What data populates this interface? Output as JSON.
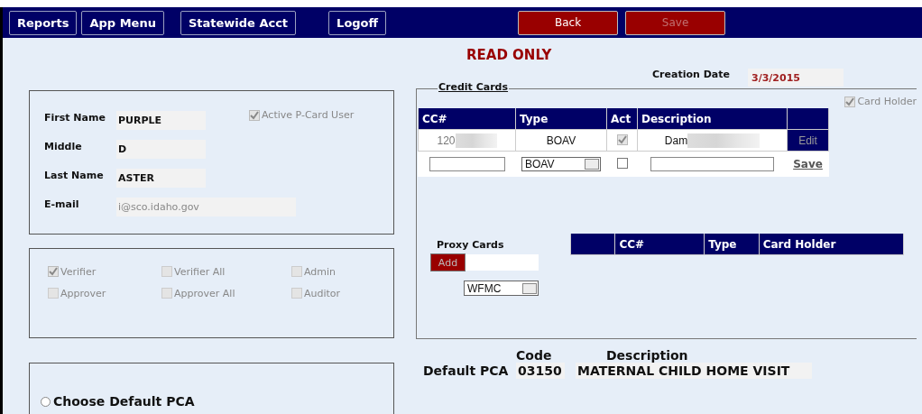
{
  "nav": {
    "buttons": [
      {
        "label": "Reports",
        "kind": "outline",
        "disabled": false
      },
      {
        "label": "App Menu",
        "kind": "outline",
        "disabled": false
      },
      {
        "label": "Statewide Acct",
        "kind": "outline",
        "disabled": false
      },
      {
        "label": "Logoff",
        "kind": "outline",
        "disabled": false
      },
      {
        "label": "Back",
        "kind": "primary",
        "disabled": false
      },
      {
        "label": "Save",
        "kind": "primary",
        "disabled": true
      }
    ]
  },
  "status": "READ ONLY",
  "creation_date": {
    "label": "Creation Date",
    "value": "3/3/2015"
  },
  "user": {
    "fields": [
      {
        "label": "First Name",
        "value": "PURPLE"
      },
      {
        "label": "Middle",
        "value": "D"
      },
      {
        "label": "Last Name",
        "value": "ASTER"
      },
      {
        "label": "E-mail",
        "value": "i@sco.idaho.gov",
        "kind": "email"
      }
    ],
    "active": {
      "label": "Active P-Card User",
      "checked": true
    }
  },
  "roles": [
    {
      "label": "Verifier",
      "checked": true
    },
    {
      "label": "Verifier All",
      "checked": false
    },
    {
      "label": "Admin",
      "checked": false
    },
    {
      "label": "Approver",
      "checked": false
    },
    {
      "label": "Approver All",
      "checked": false
    },
    {
      "label": "Auditor",
      "checked": false
    }
  ],
  "default_pca_choice": {
    "label": "Choose Default PCA",
    "selected": false
  },
  "credit_cards": {
    "legend": "Credit Cards",
    "card_holder": {
      "label": "Card Holder",
      "checked": true
    },
    "columns": [
      "CC#",
      "Type",
      "Act",
      "Description"
    ],
    "rows": [
      {
        "cc": "120",
        "type": "BOAV",
        "active": true,
        "description": "Dam",
        "action": "Edit",
        "redacted": true
      }
    ],
    "new_row": {
      "type": "BOAV",
      "active": false,
      "action": "Save"
    }
  },
  "proxy": {
    "label": "Proxy Cards",
    "add": "Add",
    "type": "WFMC",
    "columns": [
      "CC#",
      "Type",
      "Card Holder"
    ]
  },
  "default_pca": {
    "label": "Default PCA",
    "code_header": "Code",
    "description_header": "Description",
    "code": "03150",
    "description": "MATERNAL CHILD HOME VISIT"
  }
}
